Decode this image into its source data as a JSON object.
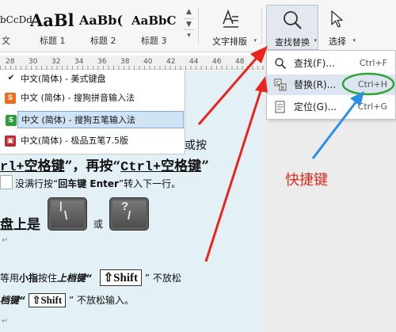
{
  "ribbon": {
    "styles": [
      {
        "sample": "bCcDd",
        "name": "文"
      },
      {
        "sample": "AaBl",
        "name": "标题 1"
      },
      {
        "sample": "AaBb(",
        "name": "标题 2"
      },
      {
        "sample": "AaBbC",
        "name": "标题 3"
      }
    ],
    "text_layout_label": "文字排版",
    "find_replace_label": "查找替换",
    "select_label": "选择"
  },
  "ruler": {
    "numbers": [
      "28",
      "30",
      "32",
      "34",
      "36",
      "38",
      "40",
      "42",
      "44",
      "46",
      "48"
    ]
  },
  "ime": {
    "items": [
      {
        "label": "中文(简体) - 美式键盘"
      },
      {
        "label": "中文 (简体) - 搜狗拼音输入法"
      },
      {
        "label": "中文 (简体) - 搜狗五笔输入法"
      },
      {
        "label": "中文(简体) - 极品五笔7.5版"
      }
    ]
  },
  "document": {
    "line1_tail": "或按",
    "line2_a": "rl+空格键",
    "line2_mid": "”，再按“",
    "line2_b": "Ctrl+空格键",
    "line2_end": "”",
    "line3_a": "没满行按“",
    "line3_key": "回车键 Enter",
    "line3_b": "”转入下一行。",
    "line4_a": "盘上是",
    "line4_or": "或",
    "line5_a": "等用",
    "line5_b": "小指",
    "line5_c": "按住",
    "line5_d": "上档键“",
    "line5_shift": "⇧Shift",
    "line5_e": "” 不放松",
    "line6_a": "档键“",
    "line6_shift": "⇧Shift",
    "line6_b": "” 不放松输入。"
  },
  "dropdown": {
    "items": [
      {
        "label": "查找(F)...",
        "shortcut": "Ctrl+F"
      },
      {
        "label": "替换(R)...",
        "shortcut": "Ctrl+H"
      },
      {
        "label": "定位(G)...",
        "shortcut": "Ctrl+G"
      }
    ]
  },
  "annotation": {
    "text": "快捷键"
  },
  "colors": {
    "arrow_red": "#e8261b",
    "circle_green": "#2fa33a",
    "arrow_blue": "#2a8fe6"
  }
}
